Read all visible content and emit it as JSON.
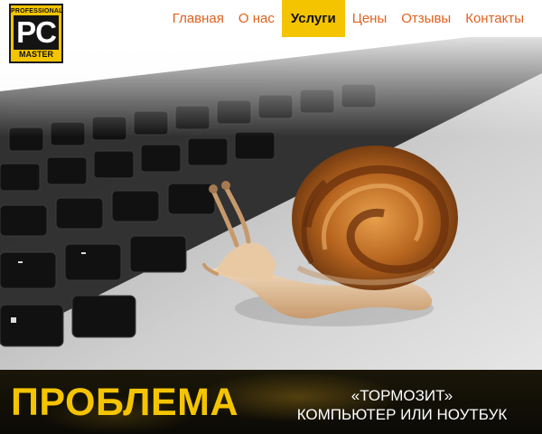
{
  "logo": {
    "top": "PROFESSIONAL",
    "big": "PC",
    "bottom": "MASTER"
  },
  "nav": {
    "items": [
      {
        "label": "Главная",
        "active": false
      },
      {
        "label": "О нас",
        "active": false
      },
      {
        "label": "Услуги",
        "active": true
      },
      {
        "label": "Цены",
        "active": false
      },
      {
        "label": "Отзывы",
        "active": false
      },
      {
        "label": "Контакты",
        "active": false
      }
    ]
  },
  "banner": {
    "main": "ПРОБЛЕМА",
    "sub_line1": "«ТОРМОЗИТ»",
    "sub_line2": "КОМПЬЮТЕР ИЛИ НОУТБУК"
  },
  "colors": {
    "accent_yellow": "#f4c400",
    "nav_text": "#e0611c",
    "banner_bg": "#0b0a05"
  }
}
